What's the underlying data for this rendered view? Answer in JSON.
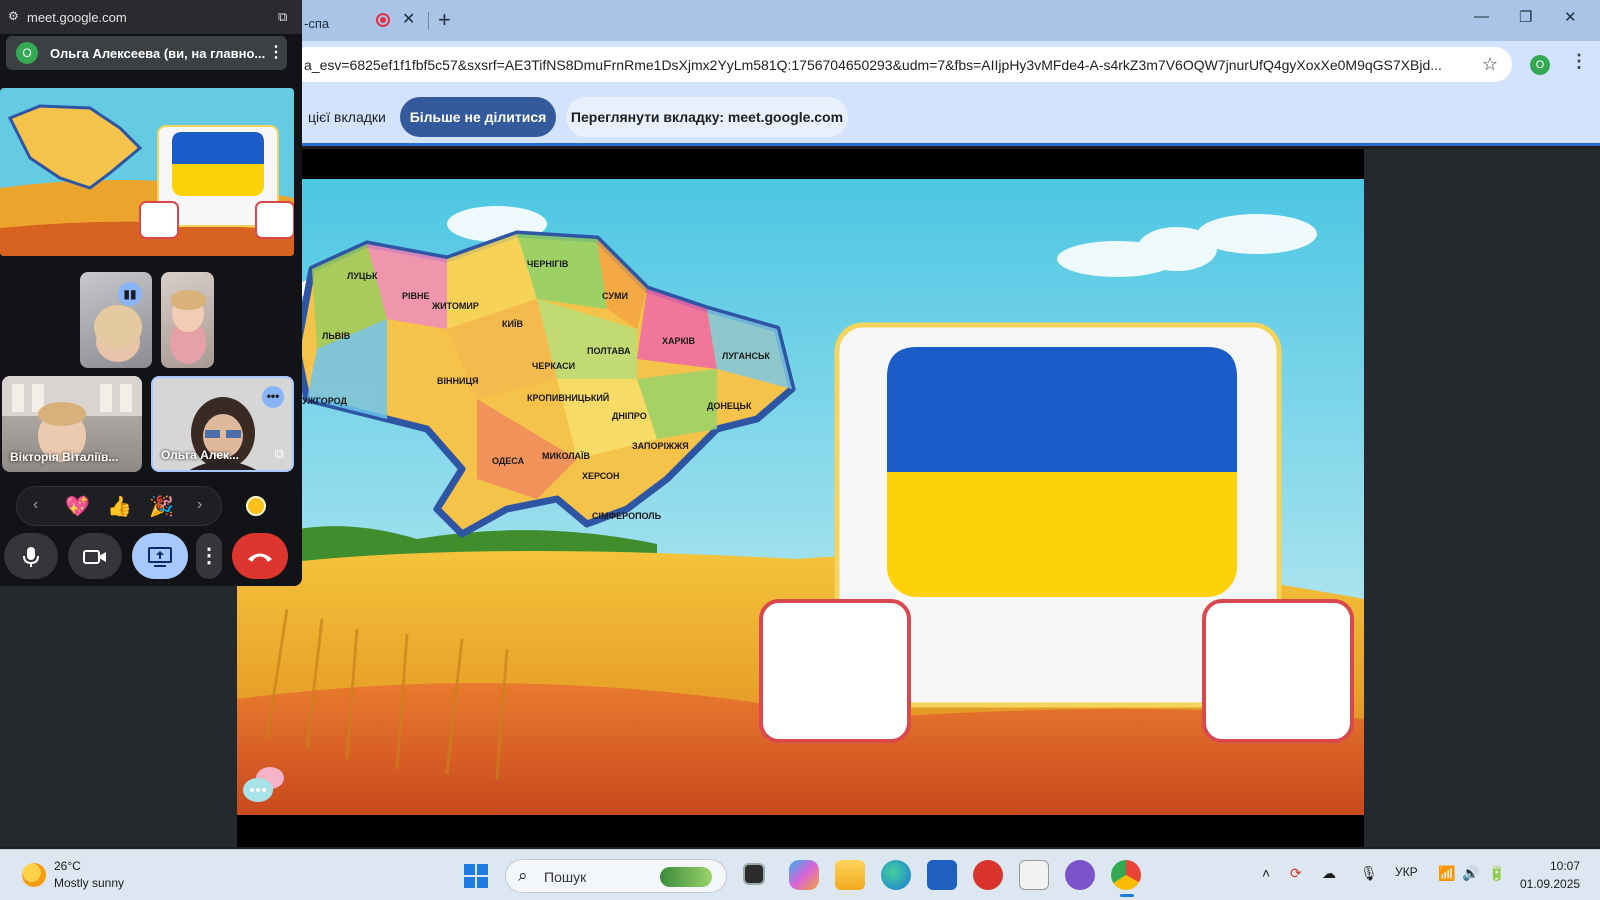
{
  "browser": {
    "tab_label": "-спа",
    "url": "a_esv=6825ef1f1fbf5c57&sxsrf=AE3TifNS8DmuFrnRme1DsXjmx2YyLm581Q:1756704650293&udm=7&fbs=AIIjpHy3vMFde4-A-s4rkZ3m7V6OQW7jnurUfQ4gyXoxXe0M9qGS7XBjd...",
    "profile_initial": "O"
  },
  "sharebar": {
    "share_text": "цієї вкладки",
    "stop_label": "Більше не ділитися",
    "view_label": "Переглянути вкладку: meet.google.com"
  },
  "slide": {
    "map_cities": [
      "ЧЕРНІГІВ",
      "СУМИ",
      "ХАРКІВ",
      "ЛУГАНСЬК",
      "КИЇВ",
      "ПОЛТАВА",
      "ДОНЕЦЬК",
      "ДНІПРО",
      "ЗАПОРІЖЖЯ",
      "ЧЕРКАСИ",
      "КРОПИВНИЦЬКИЙ",
      "ЖИТОМИР",
      "ЛУЦЬК",
      "РІВНЕ",
      "ЛЬВІВ",
      "ВІННИЦЯ",
      "ОДЕСА",
      "МИКОЛАЇВ",
      "ХЕРСОН",
      "СІМФЕРОПОЛЬ",
      "УЖГОРОД"
    ],
    "flag_colors": {
      "top": "#1b5cc8",
      "bottom": "#fed20a"
    }
  },
  "pip": {
    "site": "meet.google.com",
    "user_initial": "O",
    "user_name": "Ольга Алексеева (ви, на главно...",
    "tiles": [
      {
        "name": ""
      },
      {
        "name": ""
      },
      {
        "name": "Вікторія Віталіїв..."
      },
      {
        "name": "Ольга Алек..."
      }
    ],
    "reactions": [
      "💖",
      "👍",
      "🎉"
    ]
  },
  "taskbar": {
    "temp": "26°C",
    "weather": "Mostly sunny",
    "search_placeholder": "Пошук",
    "lang": "УКР",
    "time": "10:07",
    "date": "01.09.2025"
  },
  "colors": {
    "accent": "#2b6ccf",
    "end_call": "#dc362e",
    "share_active": "#a8c7fa"
  }
}
